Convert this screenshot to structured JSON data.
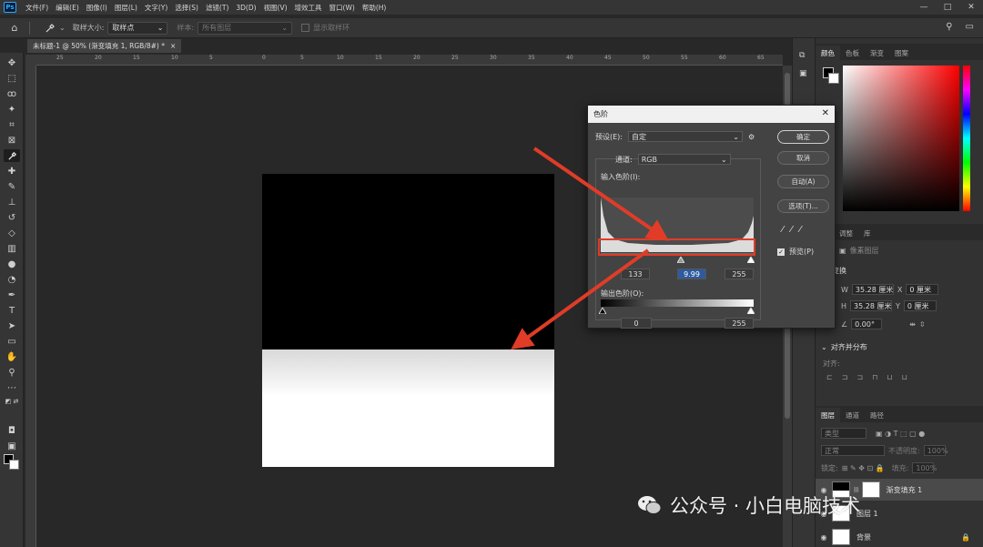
{
  "menubar": {
    "logo": "Ps",
    "items": [
      "文件(F)",
      "编辑(E)",
      "图像(I)",
      "图层(L)",
      "文字(Y)",
      "选择(S)",
      "滤镜(T)",
      "3D(D)",
      "视图(V)",
      "增效工具",
      "窗口(W)",
      "帮助(H)"
    ],
    "win_min": "—",
    "win_max": "□",
    "win_close": "✕"
  },
  "options": {
    "sample_size_label": "取样大小:",
    "sample_size_value": "取样点",
    "sample_label": "样本:",
    "sample_value": "所有图层",
    "show_ring_label": "显示取样环"
  },
  "document": {
    "tab_title": "未标题-1 @ 50% (渐变填充 1, RGB/8#) *",
    "tab_close": "×"
  },
  "ruler_h_labels": [
    "25",
    "20",
    "15",
    "10",
    "5",
    "0",
    "5",
    "10",
    "15",
    "20",
    "25",
    "30",
    "35",
    "40",
    "45",
    "50",
    "55",
    "60",
    "65"
  ],
  "dialog": {
    "title": "色阶",
    "close": "✕",
    "preset_label": "预设(E):",
    "preset_value": "自定",
    "channel_label": "通道:",
    "channel_value": "RGB",
    "input_label": "输入色阶(I):",
    "input_black": "133",
    "input_gray": "9.99",
    "input_white": "255",
    "output_label": "输出色阶(O):",
    "output_black": "0",
    "output_white": "255",
    "btn_ok": "确定",
    "btn_cancel": "取消",
    "btn_auto": "自动(A)",
    "btn_options": "选项(T)...",
    "preview_label": "预览(P)"
  },
  "right_panel": {
    "color_tabs": [
      "颜色",
      "色板",
      "渐变",
      "图案"
    ],
    "props_tabs": [
      "调整",
      "库"
    ],
    "props_pixel_layer": "像素图层",
    "transform_label": "变换",
    "w_label": "W",
    "w_value": "35.28 厘米",
    "h_label": "H",
    "h_value": "35.28 厘米",
    "x_label": "X",
    "x_value": "0 厘米",
    "y_label": "Y",
    "y_value": "0 厘米",
    "angle_value": "0.00°",
    "align_label": "对齐并分布",
    "align_sub": "对齐:",
    "layers_tabs": [
      "图层",
      "通道",
      "路径"
    ],
    "kind_placeholder": "类型",
    "blend_mode": "正常",
    "opacity_label": "不透明度:",
    "opacity_value": "100%",
    "lock_label": "锁定:",
    "fill_label": "填充:",
    "fill_value": "100%",
    "layers": [
      {
        "name": "渐变填充 1"
      },
      {
        "name": "图层 1"
      },
      {
        "name": "背景"
      }
    ]
  },
  "watermark": "公众号 · 小白电脑技术"
}
